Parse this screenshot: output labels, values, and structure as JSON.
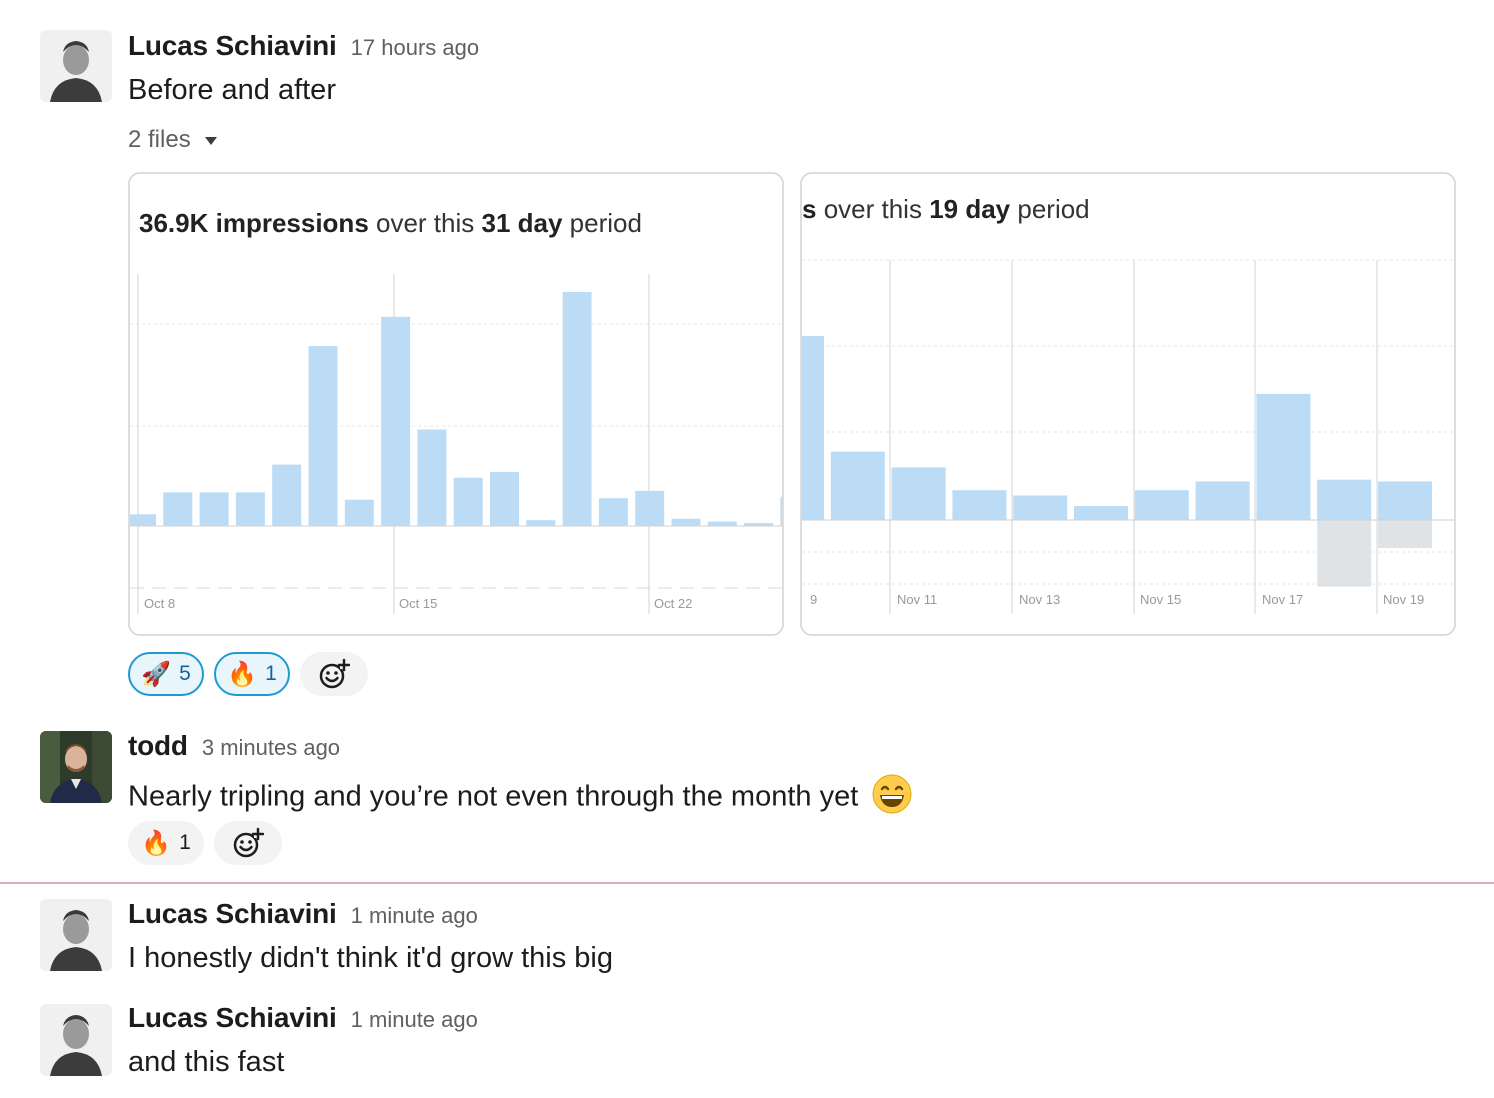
{
  "messages": [
    {
      "author": "Lucas Schiavini",
      "time": "17 hours ago",
      "text": "Before and after"
    },
    {
      "author": "todd",
      "time": "3 minutes ago",
      "text": "Nearly tripling and you’re not even through the month yet"
    },
    {
      "author": "Lucas Schiavini",
      "time": "1 minute ago",
      "text": "I honestly didn't think it'd grow this big"
    },
    {
      "author": "Lucas Schiavini",
      "time": "1 minute ago",
      "text": "and this fast"
    }
  ],
  "attachments": {
    "files_label": "2 files",
    "caret_icon": "caret-down-icon"
  },
  "reactions": {
    "msg1": [
      {
        "emoji": "🚀",
        "name": "rocket-icon",
        "count": "5",
        "active": true
      },
      {
        "emoji": "🔥",
        "name": "fire-icon",
        "count": "1",
        "active": true
      }
    ],
    "msg2": [
      {
        "emoji": "🔥",
        "name": "fire-icon",
        "count": "1",
        "active": false
      }
    ]
  },
  "inline_emoji": "grinning-face-icon",
  "colors": {
    "bar": "#bcdcf5",
    "bar_gray": "#dfe3e6",
    "reaction_border": "#1d9bd1",
    "divider": "#e7a6c3"
  },
  "chart_data": [
    {
      "type": "bar",
      "title_parts": {
        "pre": "36.9K impressions",
        "mid": " over this ",
        "num": "31 day",
        "post": " period"
      },
      "tick_labels": [
        "Oct 8",
        "Oct 15",
        "Oct 22"
      ],
      "values": [
        0.8,
        2.3,
        2.3,
        2.3,
        4.2,
        12.3,
        1.8,
        14.3,
        6.6,
        3.3,
        3.7,
        0.4,
        16,
        1.9,
        2.4,
        0.5,
        0.3,
        0.2,
        2.0
      ]
    },
    {
      "type": "bar",
      "title_parts": {
        "pre": "s",
        "mid": " over this ",
        "num": "19 day",
        "post": " period"
      },
      "tick_labels": [
        "9",
        "Nov 11",
        "Nov 13",
        "Nov 15",
        "Nov 17",
        "Nov 19"
      ],
      "values": [
        10.5,
        3.9,
        3.0,
        1.7,
        1.4,
        0.8,
        1.7,
        2.2,
        7.2,
        2.3,
        2.2
      ],
      "negative_values": [
        0,
        0,
        0,
        0,
        0,
        0,
        0,
        0,
        0,
        3.8,
        1.6
      ]
    }
  ]
}
